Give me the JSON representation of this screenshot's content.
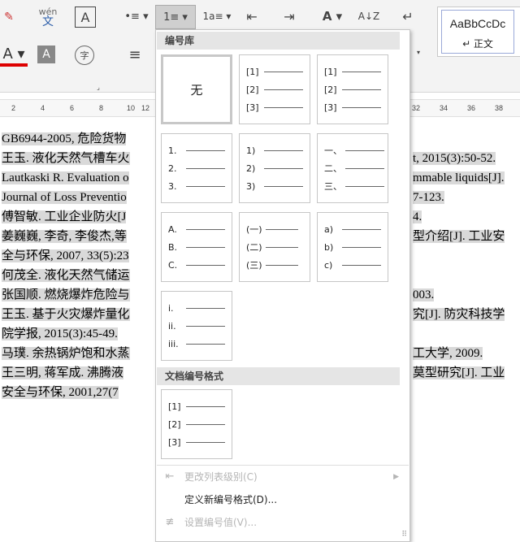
{
  "ribbon": {
    "buttons": [
      {
        "name": "clear-format-button",
        "glyph": "✎",
        "x": "",
        "y": ""
      },
      {
        "name": "phonetic-guide-button",
        "glyph": "wén\n文"
      },
      {
        "name": "character-border-button",
        "glyph": "A"
      },
      {
        "name": "bullets-button",
        "glyph": "•≡"
      },
      {
        "name": "numbering-button",
        "glyph": "1≡"
      },
      {
        "name": "multilevel-list-button",
        "glyph": "1.a≡"
      },
      {
        "name": "decrease-indent-button",
        "glyph": "⇤"
      },
      {
        "name": "increase-indent-button",
        "glyph": "⇥"
      },
      {
        "name": "text-direction-button",
        "glyph": "A"
      },
      {
        "name": "sort-button",
        "glyph": "A↓Z"
      },
      {
        "name": "show-marks-button",
        "glyph": "↵"
      },
      {
        "name": "font-color-button",
        "glyph": "A"
      },
      {
        "name": "character-shading-button",
        "glyph": "A"
      },
      {
        "name": "enclose-characters-button",
        "glyph": "字"
      },
      {
        "name": "align-button",
        "glyph": "≡"
      }
    ],
    "styles": {
      "sample": "AaBbCcDc",
      "name": "↵ 正文"
    }
  },
  "ruler": {
    "ticks": [
      "2",
      "4",
      "6",
      "8",
      "10",
      "12",
      "32",
      "34",
      "36",
      "38"
    ]
  },
  "document": {
    "lines": [
      "GB6944-2005, 危险货物",
      "王玉. 液化天然气槽车火",
      "Lautkaski R. Evaluation o",
      "Journal of Loss Preventio",
      "傅智敏. 工业企业防火[J",
      "姜巍巍, 李奇, 李俊杰,等",
      "全与环保, 2007, 33(5):23",
      "何茂全. 液化天然气储运",
      "张国顺. 燃烧爆炸危险与",
      "王玉. 基于火灾爆炸量化",
      "院学报, 2015(3):45-49.",
      "马璞. 余热锅炉饱和水蒸",
      "王三明, 蒋军成. 沸腾液",
      "安全与环保,   2001,27(7"
    ],
    "right_fragments": [
      "",
      "t, 2015(3):50-52.",
      "mmable liquids[J].",
      "7-123.",
      "4.",
      "型介绍[J]. 工业安",
      "",
      "",
      "003.",
      "究[J]. 防灾科技学",
      "",
      "工大学, 2009.",
      "莫型研究[J]. 工业",
      ""
    ]
  },
  "menu": {
    "library_title": "编号库",
    "doc_formats_title": "文档编号格式",
    "none_label": "无",
    "tiles": [
      {
        "labels": [
          "[1]",
          "[2]",
          "[3]"
        ]
      },
      {
        "labels": [
          "[1]",
          "[2]",
          "[3]"
        ]
      },
      {
        "labels": [
          "1.",
          "2.",
          "3."
        ]
      },
      {
        "labels": [
          "1)",
          "2)",
          "3)"
        ]
      },
      {
        "labels": [
          "一、",
          "二、",
          "三、"
        ]
      },
      {
        "labels": [
          "A.",
          "B.",
          "C."
        ]
      },
      {
        "labels": [
          "(一)",
          "(二)",
          "(三)"
        ]
      },
      {
        "labels": [
          "a)",
          "b)",
          "c)"
        ]
      },
      {
        "labels": [
          "i.",
          "ii.",
          "iii."
        ]
      }
    ],
    "doc_tile": {
      "labels": [
        "[1]",
        "[2]",
        "[3]"
      ]
    },
    "items": [
      {
        "label": "更改列表级别(C)",
        "icon": "⇤",
        "disabled": true,
        "submenu": true
      },
      {
        "label": "定义新编号格式(D)...",
        "icon": "",
        "disabled": false,
        "submenu": false
      },
      {
        "label": "设置编号值(V)...",
        "icon": "≢",
        "disabled": true,
        "submenu": false
      }
    ]
  }
}
